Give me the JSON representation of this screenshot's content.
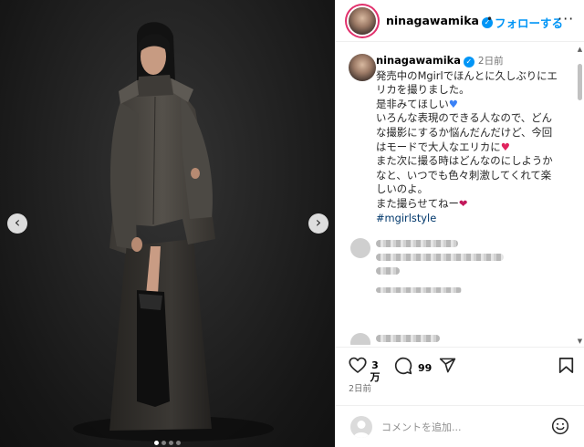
{
  "colors": {
    "accent": "#0095f6",
    "hashtag": "#00376b",
    "muted": "#737373"
  },
  "post": {
    "username": "ninagawamika",
    "follow_label": "フォローする",
    "header_separator": "•",
    "more_icon": "more-options-icon"
  },
  "caption": {
    "username": "ninagawamika",
    "time": "2日前",
    "lines": [
      "発売中のMgirlでほんとに久しぶりにエ",
      "リカを撮りました。",
      "是非みてほしい",
      "いろんな表現のできる人なので、どん",
      "な撮影にするか悩んだんだけど、今回",
      "はモードで大人なエリカに",
      "また次に撮る時はどんなのにしようか",
      "なと、いつでも色々刺激してくれて楽",
      "しいのよ。",
      "また撮らせてねー"
    ],
    "hashtag": "#mgirlstyle"
  },
  "actions": {
    "likes_top": "3",
    "likes_bottom": "万",
    "comments": "99"
  },
  "date": "2日前",
  "comment_box": {
    "placeholder": "コメントを追加..."
  },
  "carousel": {
    "slides": 4,
    "active": 0
  }
}
